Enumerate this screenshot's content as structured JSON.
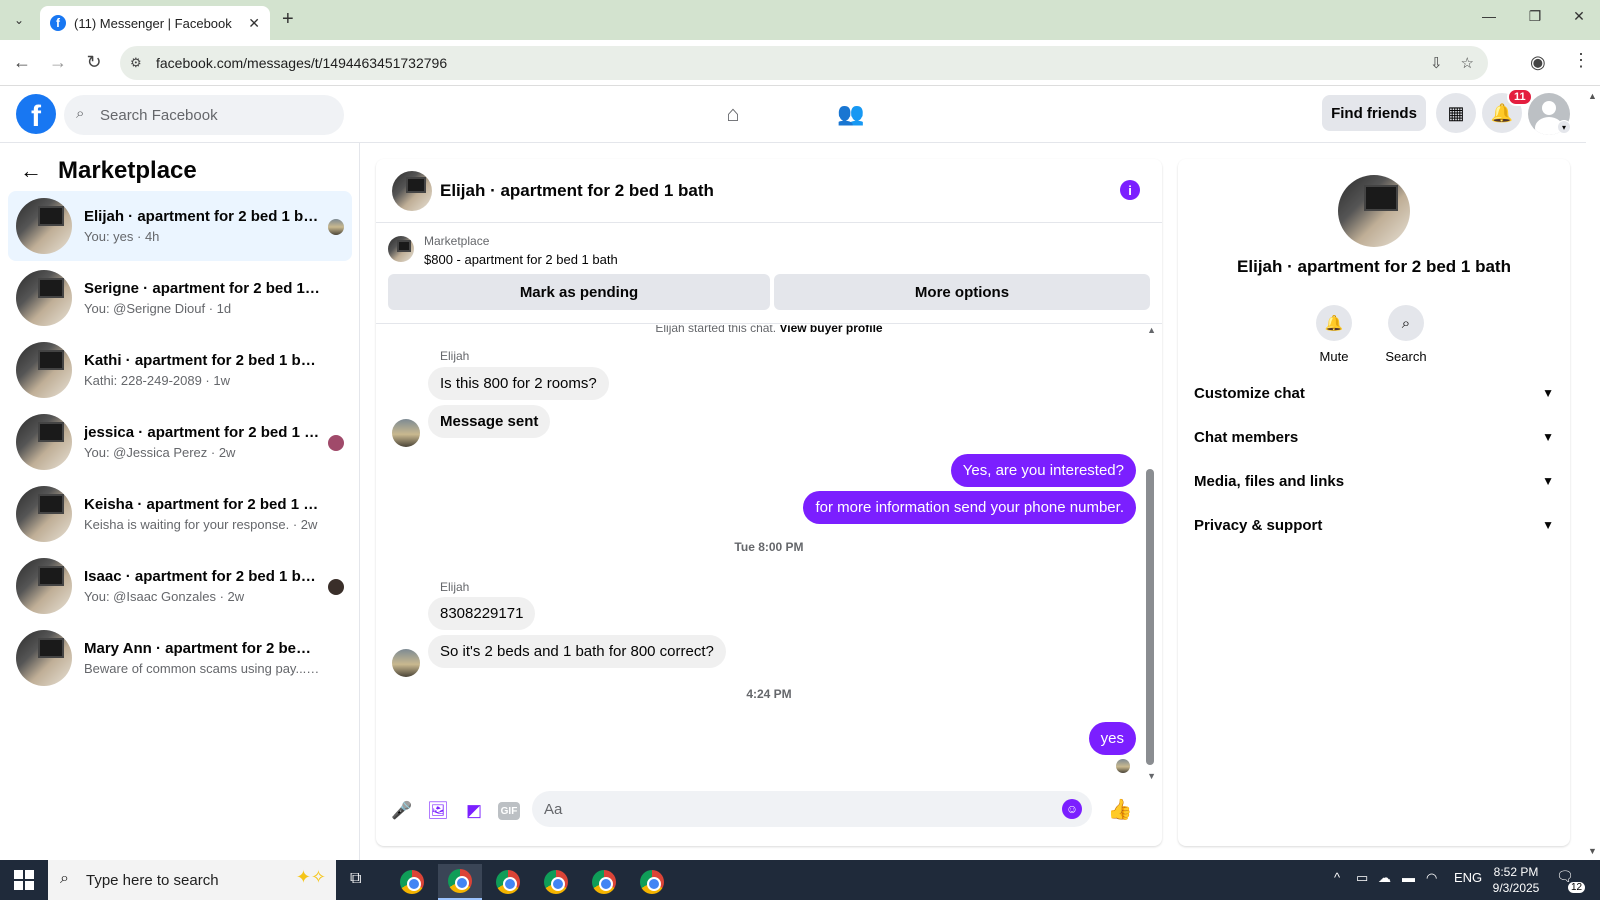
{
  "browser": {
    "tab_title": "(11) Messenger | Facebook",
    "url": "facebook.com/messages/t/1494463451732796"
  },
  "header": {
    "search_placeholder": "Search Facebook",
    "find_friends": "Find friends",
    "notification_count": "11"
  },
  "sidebar": {
    "title": "Marketplace",
    "conversations": [
      {
        "name": "Elijah · apartment for 2 bed 1 bath",
        "sub": "You: yes · 4h",
        "active": true
      },
      {
        "name": "Serigne · apartment for 2 bed 1 bath",
        "sub": "You: @Serigne Diouf · 1d"
      },
      {
        "name": "Kathi · apartment for 2 bed 1 bath",
        "sub": "Kathi: 228-249-2089 · 1w"
      },
      {
        "name": "jessica · apartment for 2 bed 1 b...",
        "sub": "You: @Jessica Perez · 2w"
      },
      {
        "name": "Keisha · apartment for 2 bed 1 bath",
        "sub": "Keisha is waiting for your response. · 2w"
      },
      {
        "name": "Isaac · apartment for 2 bed 1 bath",
        "sub": "You: @Isaac Gonzales · 2w"
      },
      {
        "name": "Mary Ann · apartment for 2 bed 1 ...",
        "sub": "Beware of common scams using pay...  · 2w"
      }
    ]
  },
  "chat": {
    "title": "Elijah · apartment for 2 bed 1 bath",
    "marketplace_label": "Marketplace",
    "listing": "$800 - apartment for 2 bed 1 bath",
    "mark_pending": "Mark as pending",
    "more_options": "More options",
    "started_text": "Elijah started this chat.",
    "view_buyer": "View buyer profile",
    "sender": "Elijah",
    "msg1": "Is this 800 for 2 rooms?",
    "msg2": "Message sent",
    "out1": "Yes, are you interested?",
    "out2": "for more information send your phone number.",
    "ts1": "Tue 8:00 PM",
    "msg3": "8308229171",
    "msg4": "So it's 2 beds and 1 bath for 800 correct?",
    "ts2": "4:24 PM",
    "out3": "yes",
    "composer_placeholder": "Aa",
    "gif_label": "GIF"
  },
  "info_panel": {
    "name": "Elijah · apartment for 2 bed 1 bath",
    "mute": "Mute",
    "search": "Search",
    "sections": [
      "Customize chat",
      "Chat members",
      "Media, files and links",
      "Privacy & support"
    ]
  },
  "taskbar": {
    "search_placeholder": "Type here to search",
    "lang": "ENG",
    "time": "8:52 PM",
    "date": "9/3/2025",
    "notif_count": "12"
  }
}
